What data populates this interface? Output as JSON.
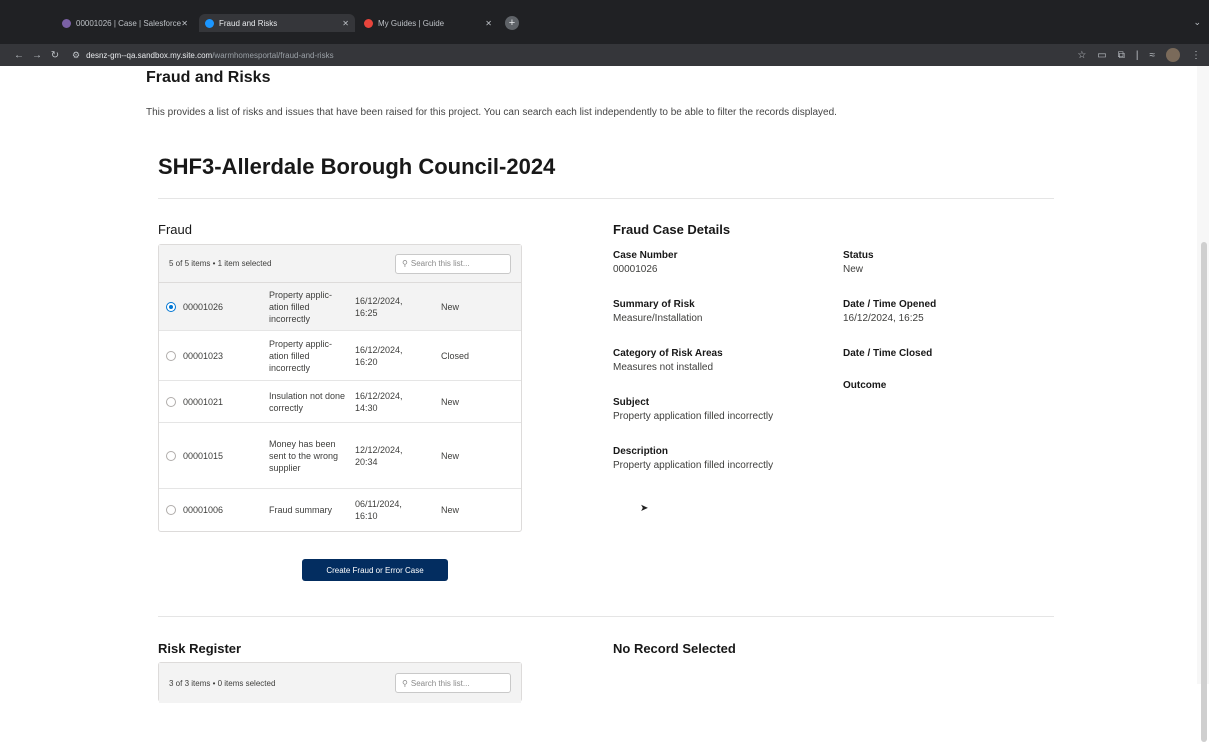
{
  "browser": {
    "tabs": [
      {
        "label": "00001026 | Case | Salesforce",
        "favicon_color": "#7b61a6"
      },
      {
        "label": "Fraud and Risks",
        "favicon_color": "#1b96ff"
      },
      {
        "label": "My Guides | Guide",
        "favicon_color": "#e8453c"
      }
    ],
    "url_host": "desnz-gm--qa.sandbox.my.site.com",
    "url_path": "/warmhomesportal/fraud-and-risks"
  },
  "page": {
    "title": "Fraud and Risks",
    "intro": "This provides a list of risks and issues that have been raised for this project. You can search each list independently to be able to filter the records displayed.",
    "project_title": "SHF3-Allerdale Borough Council-2024"
  },
  "fraud": {
    "section_title": "Fraud",
    "count_text": "5 of 5 items • 1 item selected",
    "search_placeholder": "Search this list...",
    "rows": [
      {
        "number": "00001026",
        "subject": "Property applic- ation filled incorrectly",
        "date": "16/12/2024, 16:25",
        "status": "New",
        "selected": true
      },
      {
        "number": "00001023",
        "subject": "Property applic- ation filled incorrectly",
        "date": "16/12/2024, 16:20",
        "status": "Closed",
        "selected": false
      },
      {
        "number": "00001021",
        "subject": "Insulation not done correctly",
        "date": "16/12/2024, 14:30",
        "status": "New",
        "selected": false
      },
      {
        "number": "00001015",
        "subject": "Money has been sent to the wrong supplier",
        "date": "12/12/2024, 20:34",
        "status": "New",
        "selected": false
      },
      {
        "number": "00001006",
        "subject": "Fraud summary",
        "date": "06/11/2024, 16:10",
        "status": "New",
        "selected": false
      }
    ],
    "create_button": "Create Fraud or Error Case"
  },
  "details": {
    "section_title": "Fraud Case Details",
    "case_number_label": "Case Number",
    "case_number": "00001026",
    "summary_label": "Summary of Risk",
    "summary": "Measure/Installation",
    "category_label": "Category of Risk Areas",
    "category": "Measures not installed",
    "subject_label": "Subject",
    "subject": "Property application filled incorrectly",
    "description_label": "Description",
    "description": "Property application filled incorrectly",
    "status_label": "Status",
    "status": "New",
    "opened_label": "Date / Time Opened",
    "opened": "16/12/2024, 16:25",
    "closed_label": "Date / Time Closed",
    "outcome_label": "Outcome"
  },
  "risk": {
    "section_title": "Risk Register",
    "count_text": "3 of 3 items • 0 items selected",
    "search_placeholder": "Search this list...",
    "none_selected": "No Record Selected"
  }
}
